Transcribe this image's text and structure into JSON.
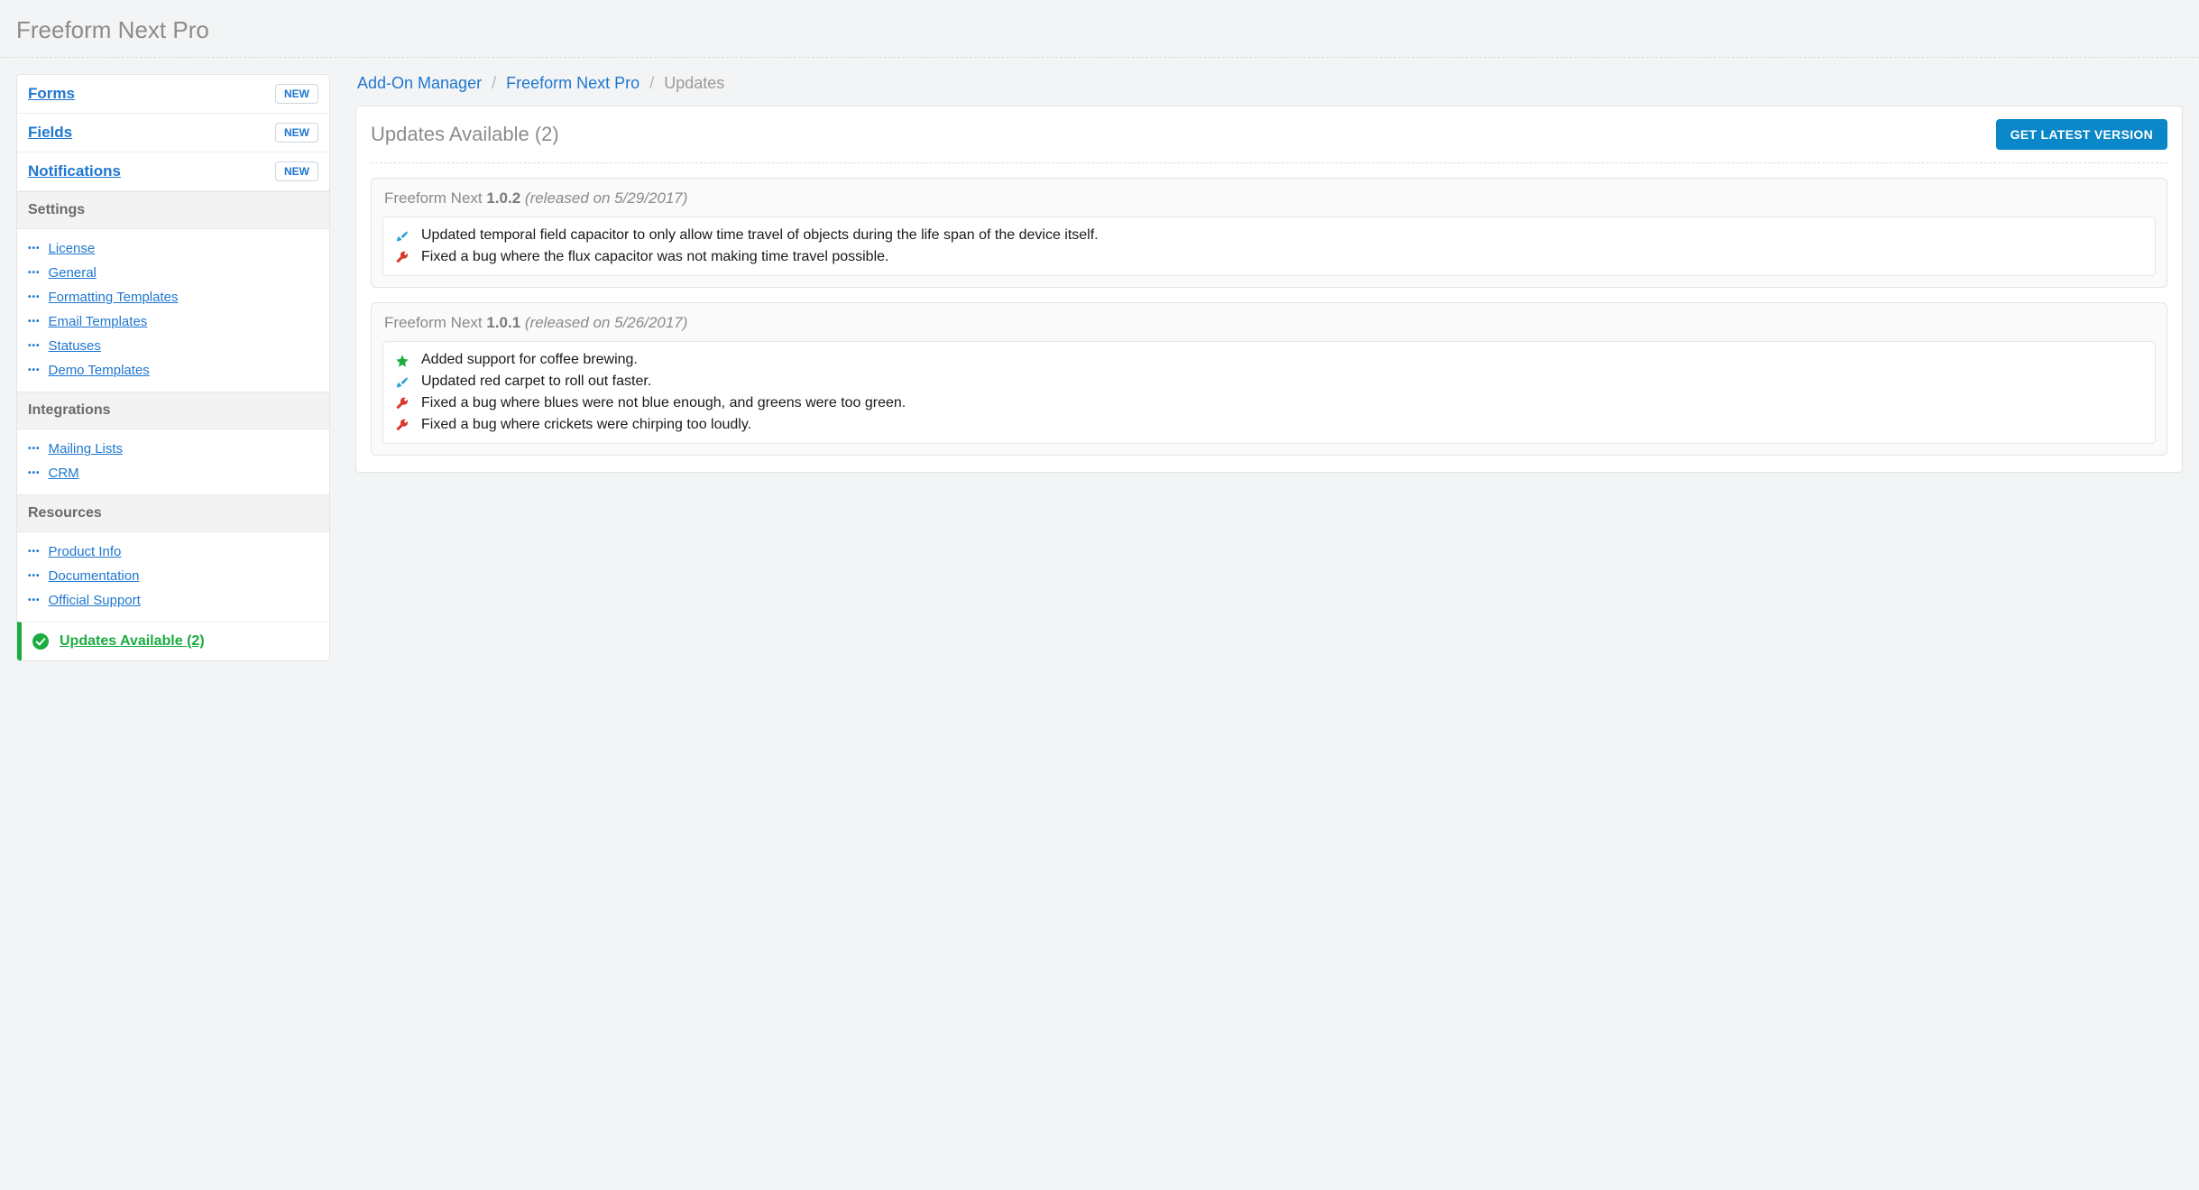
{
  "page_title": "Freeform Next Pro",
  "sidebar": {
    "primary": [
      {
        "label": "Forms",
        "new": "NEW"
      },
      {
        "label": "Fields",
        "new": "NEW"
      },
      {
        "label": "Notifications",
        "new": "NEW"
      }
    ],
    "sections": [
      {
        "header": "Settings",
        "items": [
          {
            "label": "License"
          },
          {
            "label": "General"
          },
          {
            "label": "Formatting Templates"
          },
          {
            "label": "Email Templates"
          },
          {
            "label": "Statuses"
          },
          {
            "label": "Demo Templates"
          }
        ]
      },
      {
        "header": "Integrations",
        "items": [
          {
            "label": "Mailing Lists"
          },
          {
            "label": "CRM"
          }
        ]
      },
      {
        "header": "Resources",
        "items": [
          {
            "label": "Product Info"
          },
          {
            "label": "Documentation"
          },
          {
            "label": "Official Support"
          }
        ]
      }
    ],
    "updates_label": "Updates Available (2)"
  },
  "breadcrumb": {
    "a": "Add-On Manager",
    "b": "Freeform Next Pro",
    "c": "Updates"
  },
  "panel": {
    "heading": "Updates Available (2)",
    "button": "GET LATEST VERSION"
  },
  "releases": [
    {
      "product": "Freeform Next ",
      "version": "1.0.2",
      "date": "(released on 5/29/2017)",
      "changes": [
        {
          "type": "improvement",
          "text": "Updated temporal field capacitor to only allow time travel of objects during the life span of the device itself."
        },
        {
          "type": "fix",
          "text": "Fixed a bug where the flux capacitor was not making time travel possible."
        }
      ]
    },
    {
      "product": "Freeform Next ",
      "version": "1.0.1",
      "date": "(released on 5/26/2017)",
      "changes": [
        {
          "type": "feature",
          "text": "Added support for coffee brewing."
        },
        {
          "type": "improvement",
          "text": "Updated red carpet to roll out faster."
        },
        {
          "type": "fix",
          "text": "Fixed a bug where blues were not blue enough, and greens were too green."
        },
        {
          "type": "fix",
          "text": "Fixed a bug where crickets were chirping too loudly."
        }
      ]
    }
  ],
  "icons": {
    "feature_color": "#1aac3f",
    "improvement_color": "#2a9fd6",
    "fix_color": "#d9372a"
  }
}
